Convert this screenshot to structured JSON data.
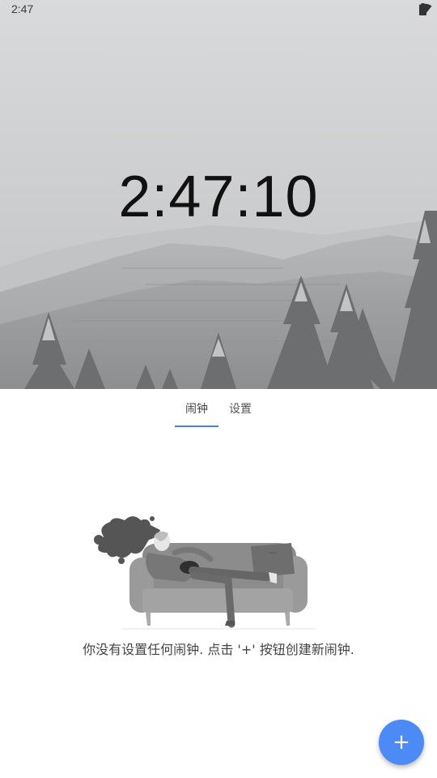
{
  "status_bar": {
    "time": "2:47",
    "icons": [
      "wifi-icon",
      "battery-icon"
    ]
  },
  "hero": {
    "clock": "2:47:10"
  },
  "tabs": [
    {
      "label": "闹钟",
      "active": true
    },
    {
      "label": "设置",
      "active": false
    }
  ],
  "empty_state": {
    "message": "你没有设置任何闹钟. 点击 '+' 按钮创建新闹钟."
  },
  "fab": {
    "icon": "plus-icon",
    "label": "+"
  },
  "colors": {
    "accent": "#4a84d8",
    "fab": "#4c8bf5"
  }
}
